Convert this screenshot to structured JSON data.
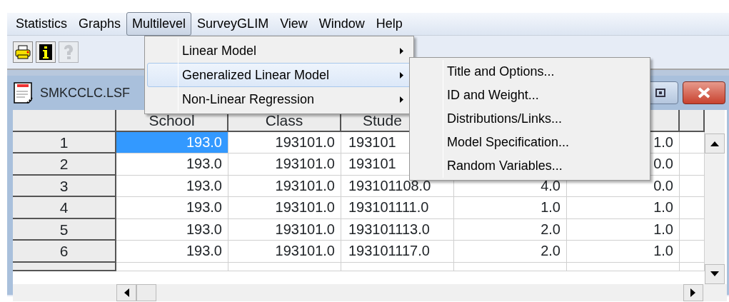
{
  "menu_bar": [
    {
      "label": "Statistics",
      "selected": false
    },
    {
      "label": "Graphs",
      "selected": false
    },
    {
      "label": "Multilevel",
      "selected": true
    },
    {
      "label": "SurveyGLIM",
      "selected": false
    },
    {
      "label": "View",
      "selected": false
    },
    {
      "label": "Window",
      "selected": false
    },
    {
      "label": "Help",
      "selected": false
    }
  ],
  "toolbar": [
    {
      "kind": "printer",
      "disabled": false
    },
    {
      "kind": "info",
      "disabled": false
    },
    {
      "kind": "help",
      "disabled": true
    }
  ],
  "dropdown": [
    {
      "label": "Linear Model",
      "selected": false,
      "submenu": true
    },
    {
      "label": "Generalized Linear Model",
      "selected": true,
      "submenu": true
    },
    {
      "label": "Non-Linear Regression",
      "selected": false,
      "submenu": true
    }
  ],
  "submenu": [
    {
      "label": "Title and Options..."
    },
    {
      "label": "ID and Weight..."
    },
    {
      "label": "Distributions/Links..."
    },
    {
      "label": "Model Specification..."
    },
    {
      "label": "Random Variables..."
    }
  ],
  "data_window": {
    "title": "SMKCCLC.LSF",
    "columns": [
      "School",
      "Class",
      "Stude"
    ],
    "rows": [
      {
        "label": "1",
        "cells": [
          {
            "value": "193.0",
            "selected": true
          },
          {
            "value": "193101.0",
            "selected": false
          },
          {
            "value": "193101",
            "selected": false
          },
          null,
          {
            "value": "1.0",
            "selected": false
          }
        ]
      },
      {
        "label": "2",
        "cells": [
          {
            "value": "193.0",
            "selected": false
          },
          {
            "value": "193101.0",
            "selected": false
          },
          {
            "value": "193101",
            "selected": false
          },
          null,
          {
            "value": "0.0",
            "selected": false
          }
        ]
      },
      {
        "label": "3",
        "cells": [
          {
            "value": "193.0",
            "selected": false
          },
          {
            "value": "193101.0",
            "selected": false
          },
          {
            "value": "193101108.0",
            "selected": false
          },
          {
            "value": "4.0",
            "selected": false
          },
          {
            "value": "0.0",
            "selected": false
          }
        ]
      },
      {
        "label": "4",
        "cells": [
          {
            "value": "193.0",
            "selected": false
          },
          {
            "value": "193101.0",
            "selected": false
          },
          {
            "value": "193101111.0",
            "selected": false
          },
          {
            "value": "1.0",
            "selected": false
          },
          {
            "value": "1.0",
            "selected": false
          }
        ]
      },
      {
        "label": "5",
        "cells": [
          {
            "value": "193.0",
            "selected": false
          },
          {
            "value": "193101.0",
            "selected": false
          },
          {
            "value": "193101113.0",
            "selected": false
          },
          {
            "value": "2.0",
            "selected": false
          },
          {
            "value": "1.0",
            "selected": false
          }
        ]
      },
      {
        "label": "6",
        "cells": [
          {
            "value": "193.0",
            "selected": false
          },
          {
            "value": "193101.0",
            "selected": false
          },
          {
            "value": "193101117.0",
            "selected": false
          },
          {
            "value": "2.0",
            "selected": false
          },
          {
            "value": "1.0",
            "selected": false
          }
        ]
      }
    ]
  }
}
